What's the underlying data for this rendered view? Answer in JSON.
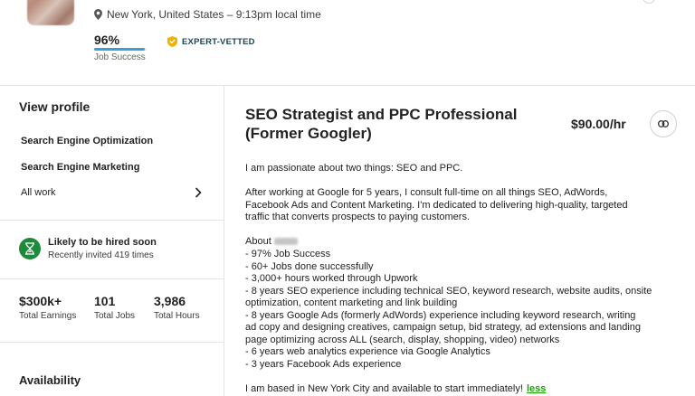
{
  "header": {
    "location": "New York, United States – 9:13pm local time",
    "job_success": {
      "value": "96%",
      "label": "Job Success",
      "fraction": 0.96
    },
    "badge": "EXPERT-VETTED"
  },
  "sidebar": {
    "view_profile": "View profile",
    "items": [
      {
        "label": "Search Engine Optimization"
      },
      {
        "label": "Search Engine Marketing"
      },
      {
        "label": "All work"
      }
    ],
    "hired": {
      "title": "Likely to be hired soon",
      "subtitle": "Recently invited 419 times"
    },
    "stats": [
      {
        "value": "$300k+",
        "label": "Total Earnings"
      },
      {
        "value": "101",
        "label": "Total Jobs"
      },
      {
        "value": "3,986",
        "label": "Total Hours"
      }
    ],
    "availability": "Availability"
  },
  "main": {
    "title_line1": "SEO Strategist and PPC Professional",
    "title_line2": "(Former Googler)",
    "rate": "$90.00/hr",
    "description": {
      "intro": "I am passionate about two things: SEO and PPC.",
      "para2": [
        "After working at Google for 5 years, I consult full-time on all things SEO, AdWords,",
        "Facebook Ads and Content Marketing. I'm dedicated to delivering high-quality, targeted",
        "traffic that converts prospects to paying customers."
      ],
      "about_label": "About",
      "bullets": [
        "- 97% Job Success",
        "- 60+ Jobs done successfully",
        "- 3,000+ hours worked through Upwork",
        "- 8 years SEO experience including technical SEO, keyword research, website audits, onsite",
        "optimization, content marketing and link building",
        "- 8 years Google Ads (formerly AdWords) experience including keyword research, writing",
        "ad copy and designing creatives, campaign setup, bid strategy, ad extensions and landing",
        "page optimizing across ALL (search, display, shopping, video) networks",
        "- 6 years web analytics experience via Google Analytics",
        "- 3 years Facebook Ads experience"
      ],
      "closing": "I am based in New York City and available to start immediately!",
      "less_link": "less"
    }
  },
  "colors": {
    "accent_green": "#14a800",
    "bar_blue": "#37a0d8",
    "badge_gold": "#f0b400",
    "hired_green": "#1f8a3b"
  }
}
